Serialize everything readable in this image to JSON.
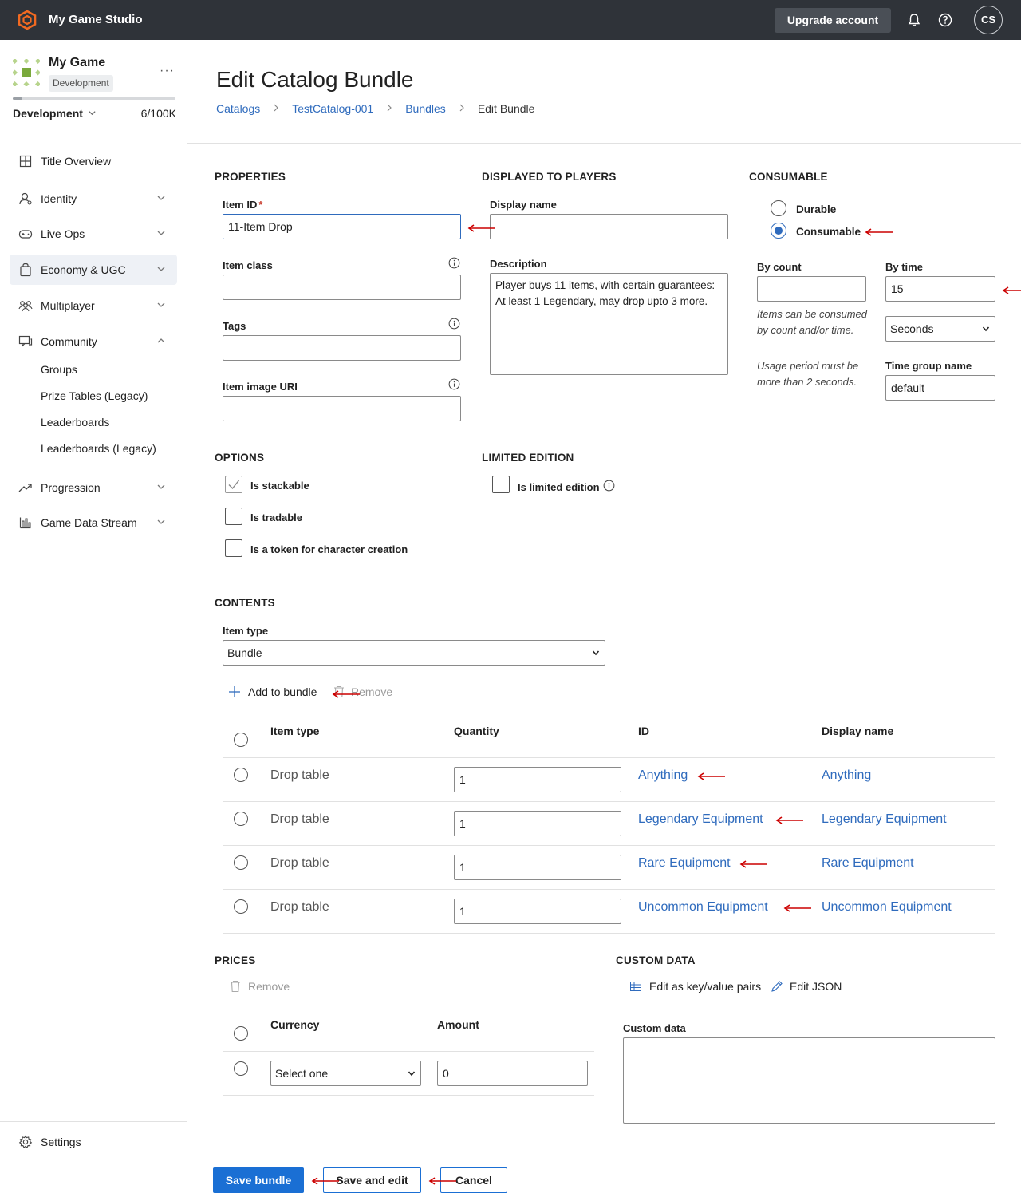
{
  "topbar": {
    "studio_name": "My Game Studio",
    "upgrade_label": "Upgrade account",
    "avatar_initials": "CS"
  },
  "sidebar": {
    "game_name": "My Game",
    "env_badge": "Development",
    "env_selector": "Development",
    "usage": "6/100K",
    "usage_fraction": 0.06,
    "items": [
      {
        "label": "Title Overview"
      },
      {
        "label": "Identity"
      },
      {
        "label": "Live Ops"
      },
      {
        "label": "Economy & UGC"
      },
      {
        "label": "Multiplayer"
      },
      {
        "label": "Community"
      },
      {
        "label": "Progression"
      },
      {
        "label": "Game Data Stream"
      }
    ],
    "community_subitems": [
      {
        "label": "Groups"
      },
      {
        "label": "Prize Tables (Legacy)"
      },
      {
        "label": "Leaderboards"
      },
      {
        "label": "Leaderboards (Legacy)"
      }
    ],
    "settings_label": "Settings"
  },
  "page": {
    "title": "Edit Catalog Bundle",
    "breadcrumb": [
      "Catalogs",
      "TestCatalog-001",
      "Bundles",
      "Edit Bundle"
    ]
  },
  "properties": {
    "section": "PROPERTIES",
    "item_id_label": "Item ID",
    "item_id_required": "*",
    "item_id_value": "11-Item Drop",
    "item_class_label": "Item class",
    "item_class_value": "",
    "tags_label": "Tags",
    "tags_value": "",
    "image_uri_label": "Item image URI",
    "image_uri_value": ""
  },
  "displayed": {
    "section": "DISPLAYED TO PLAYERS",
    "display_name_label": "Display name",
    "display_name_value": "",
    "description_label": "Description",
    "description_value": "Player buys 11 items, with certain guarantees: At least 1 Legendary, may drop upto 3 more."
  },
  "consumable": {
    "section": "CONSUMABLE",
    "durable_label": "Durable",
    "consumable_label": "Consumable",
    "selected": "Consumable",
    "by_count_label": "By count",
    "by_count_value": "",
    "by_time_label": "By time",
    "by_time_value": "15",
    "time_unit": "Seconds",
    "help_1": "Items can be consumed by count and/or time.",
    "help_2": "Usage period must be more than 2 seconds.",
    "time_group_label": "Time group name",
    "time_group_value": "default"
  },
  "options": {
    "section": "OPTIONS",
    "stackable_label": "Is stackable",
    "stackable_checked": true,
    "tradable_label": "Is tradable",
    "tradable_checked": false,
    "token_label": "Is a token for character creation",
    "token_checked": false
  },
  "limited": {
    "section": "LIMITED EDITION",
    "label": "Is limited edition",
    "checked": false
  },
  "contents": {
    "section": "CONTENTS",
    "item_type_label": "Item type",
    "item_type_value": "Bundle",
    "add_label": "Add to bundle",
    "remove_label": "Remove",
    "columns": [
      "Item type",
      "Quantity",
      "ID",
      "Display name"
    ],
    "rows": [
      {
        "type": "Drop table",
        "quantity": "1",
        "id": "Anything",
        "display": "Anything"
      },
      {
        "type": "Drop table",
        "quantity": "1",
        "id": "Legendary Equipment",
        "display": "Legendary Equipment"
      },
      {
        "type": "Drop table",
        "quantity": "1",
        "id": "Rare Equipment",
        "display": "Rare Equipment"
      },
      {
        "type": "Drop table",
        "quantity": "1",
        "id": "Uncommon Equipment",
        "display": "Uncommon Equipment"
      }
    ]
  },
  "prices": {
    "section": "PRICES",
    "remove_label": "Remove",
    "columns": [
      "Currency",
      "Amount"
    ],
    "currency_value": "Select one",
    "amount_value": "0"
  },
  "custom": {
    "section": "CUSTOM DATA",
    "edit_kv_label": "Edit as key/value pairs",
    "edit_json_label": "Edit JSON",
    "label": "Custom data",
    "value": ""
  },
  "footer": {
    "save_label": "Save bundle",
    "save_edit_label": "Save and edit",
    "cancel_label": "Cancel"
  },
  "colors": {
    "accent": "#2f6bbd",
    "primary_button": "#1a6fd4",
    "topbar": "#2f3339",
    "annotation_arrow": "#cc0000"
  }
}
